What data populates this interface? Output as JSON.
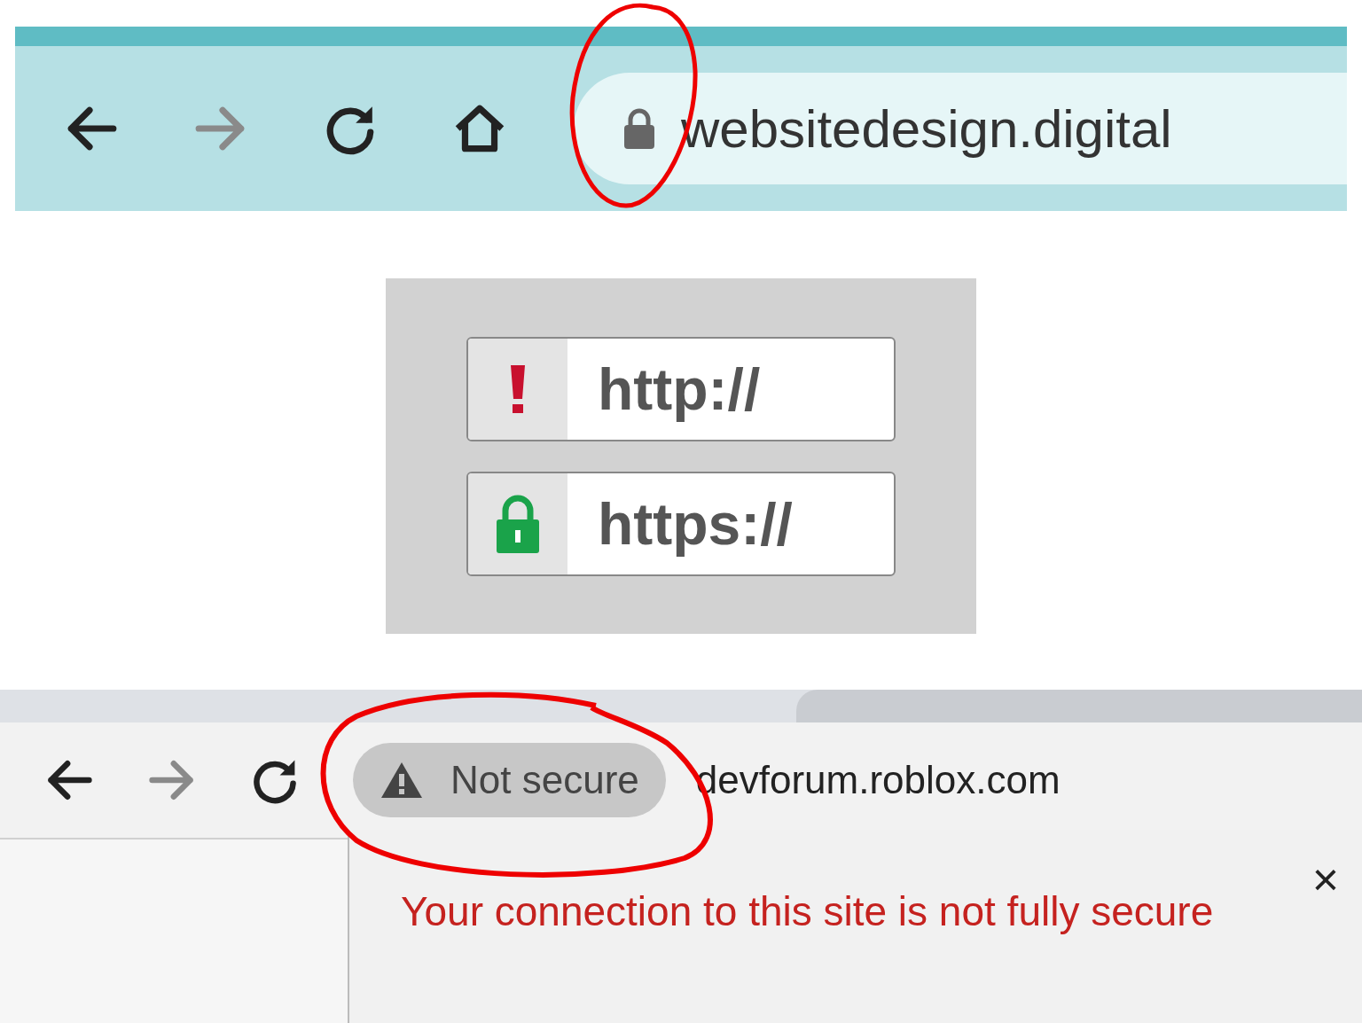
{
  "top_browser": {
    "nav": [
      {
        "kind": "back",
        "disabled": false
      },
      {
        "kind": "forward",
        "disabled": true
      },
      {
        "kind": "reload",
        "disabled": false
      },
      {
        "kind": "home",
        "disabled": false
      }
    ],
    "url": "websitedesign.digital"
  },
  "comparison": {
    "fields": [
      {
        "kind": "warning",
        "text": "http://"
      },
      {
        "kind": "lock",
        "text": "https://"
      }
    ]
  },
  "bottom_browser": {
    "nav": [
      {
        "kind": "back",
        "disabled": false
      },
      {
        "kind": "forward",
        "disabled": true
      },
      {
        "kind": "reload",
        "disabled": false
      }
    ],
    "security_chip": "Not secure",
    "url": "devforum.roblox.com",
    "popup": {
      "message": "Your connection to this site is not fully secure",
      "close": "×"
    }
  }
}
